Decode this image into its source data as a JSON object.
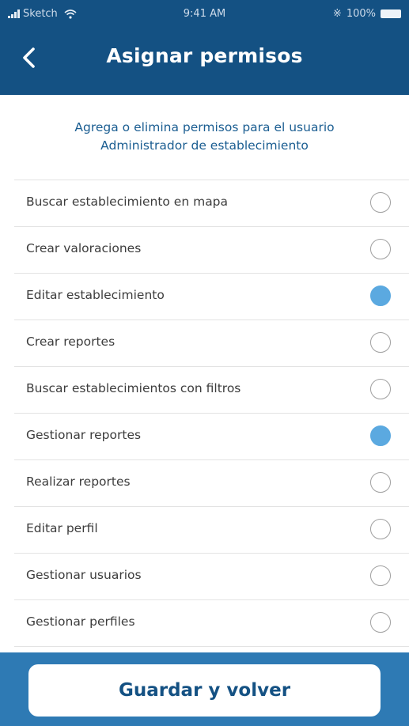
{
  "status_bar": {
    "carrier": "Sketch",
    "time": "9:41 AM",
    "battery": "100%",
    "icons": [
      "signal-icon",
      "wifi-icon",
      "bluetooth-icon",
      "battery-icon"
    ]
  },
  "header": {
    "title": "Asignar permisos",
    "back_icon": "chevron-left-icon"
  },
  "subtitle": {
    "line1": "Agrega o elimina permisos para el usuario",
    "line2": "Administrador de establecimiento"
  },
  "permissions": [
    {
      "label": "Buscar establecimiento en mapa",
      "checked": false
    },
    {
      "label": "Crear valoraciones",
      "checked": false
    },
    {
      "label": "Editar establecimiento",
      "checked": true
    },
    {
      "label": "Crear reportes",
      "checked": false
    },
    {
      "label": "Buscar establecimientos con filtros",
      "checked": false
    },
    {
      "label": "Gestionar reportes",
      "checked": true
    },
    {
      "label": "Realizar reportes",
      "checked": false
    },
    {
      "label": "Editar perfil",
      "checked": false
    },
    {
      "label": "Gestionar usuarios",
      "checked": false
    },
    {
      "label": "Gestionar perfiles",
      "checked": false
    }
  ],
  "footer": {
    "save_label": "Guardar y volver"
  },
  "colors": {
    "header_bg": "#145183",
    "subtitle_text": "#1a5d91",
    "radio_checked": "#5ba9e0",
    "footer_bg": "#2e7ab4",
    "button_text": "#145183"
  }
}
